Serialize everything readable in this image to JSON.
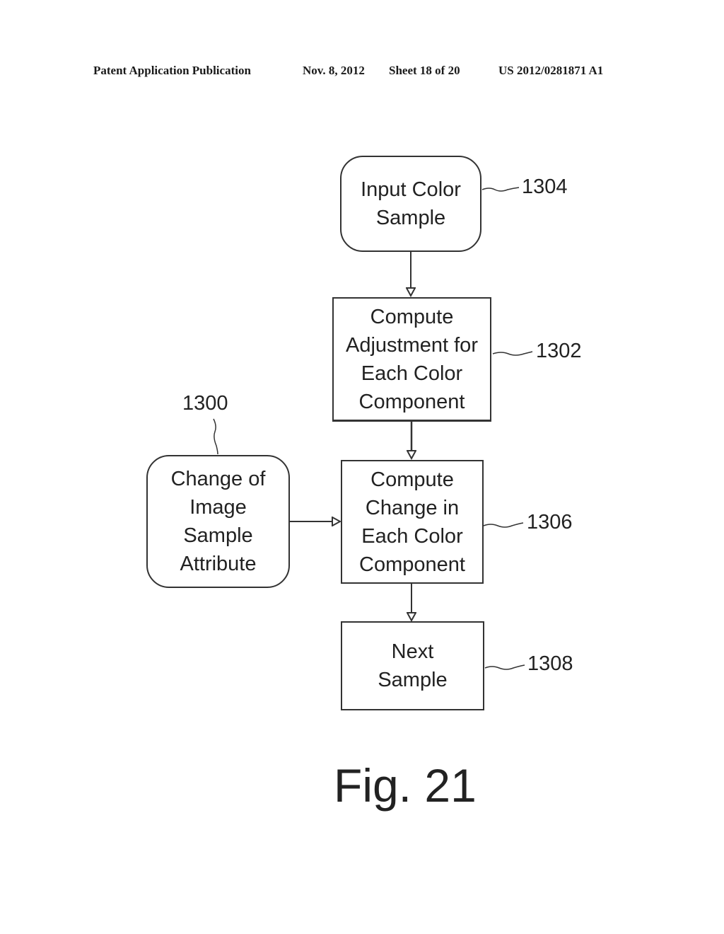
{
  "header": {
    "publication": "Patent Application Publication",
    "date": "Nov. 8, 2012",
    "sheet": "Sheet 18 of 20",
    "number": "US 2012/0281871 A1"
  },
  "figure": {
    "label": "Fig. 21",
    "nodes": [
      {
        "id": "1304",
        "shape": "rounded",
        "text": "Input Color\nSample"
      },
      {
        "id": "1302",
        "shape": "rect",
        "text": "Compute\nAdjustment for\nEach Color\nComponent"
      },
      {
        "id": "1300",
        "shape": "rounded",
        "text": "Change of\nImage\nSample\nAttribute"
      },
      {
        "id": "1306",
        "shape": "rect",
        "text": "Compute\nChange in\nEach Color\nComponent"
      },
      {
        "id": "1308",
        "shape": "rect",
        "text": "Next\nSample"
      }
    ],
    "edges": [
      {
        "from": "1304",
        "to": "1302"
      },
      {
        "from": "1302",
        "to": "1306"
      },
      {
        "from": "1300",
        "to": "1306"
      },
      {
        "from": "1306",
        "to": "1308"
      }
    ],
    "refs": {
      "r1304": "1304",
      "r1302": "1302",
      "r1300": "1300",
      "r1306": "1306",
      "r1308": "1308"
    }
  }
}
